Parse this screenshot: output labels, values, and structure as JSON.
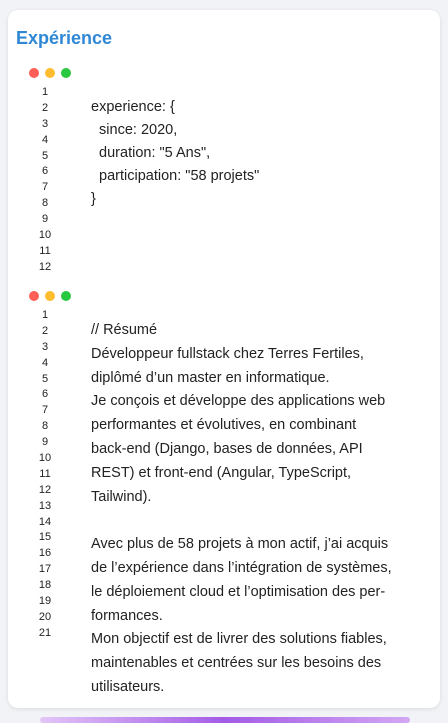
{
  "section": {
    "title": "Expérience"
  },
  "window_dots": {
    "red": "#ff5f57",
    "yellow": "#febc2e",
    "green": "#28c840"
  },
  "code_block_1": {
    "line_numbers": [
      "1",
      "2",
      "3",
      "4",
      "5",
      "6",
      "7",
      "8",
      "9",
      "10",
      "11",
      "12"
    ],
    "lines": [
      "experience: {",
      "  since: 2020,",
      "  duration: \"5 Ans\",",
      "  participation: \"58 projets\"",
      "}"
    ]
  },
  "code_block_2": {
    "line_numbers": [
      "1",
      "2",
      "3",
      "4",
      "5",
      "6",
      "7",
      "8",
      "9",
      "10",
      "11",
      "12",
      "13",
      "14",
      "15",
      "16",
      "17",
      "18",
      "19",
      "20",
      "21"
    ],
    "lines": [
      "// Résumé",
      "Développeur fullstack chez Terres Fertiles,",
      "diplômé d’un master en informatique.",
      "Je conçois et développe des applications web",
      "performantes et évolutives, en combinant",
      "back-end (Django, bases de données, API",
      "REST) et front-end (Angular, TypeScript,",
      "Tailwind).",
      "",
      "Avec plus de 58 projets à mon actif, j’ai acquis",
      "de l’expérience dans l’intégration de systèmes,",
      "le déploiement cloud et l’optimisation des per-",
      "formances.",
      "Mon objectif est de livrer des solutions fiables,",
      "maintenables et centrées sur les besoins des",
      "utilisateurs."
    ]
  }
}
